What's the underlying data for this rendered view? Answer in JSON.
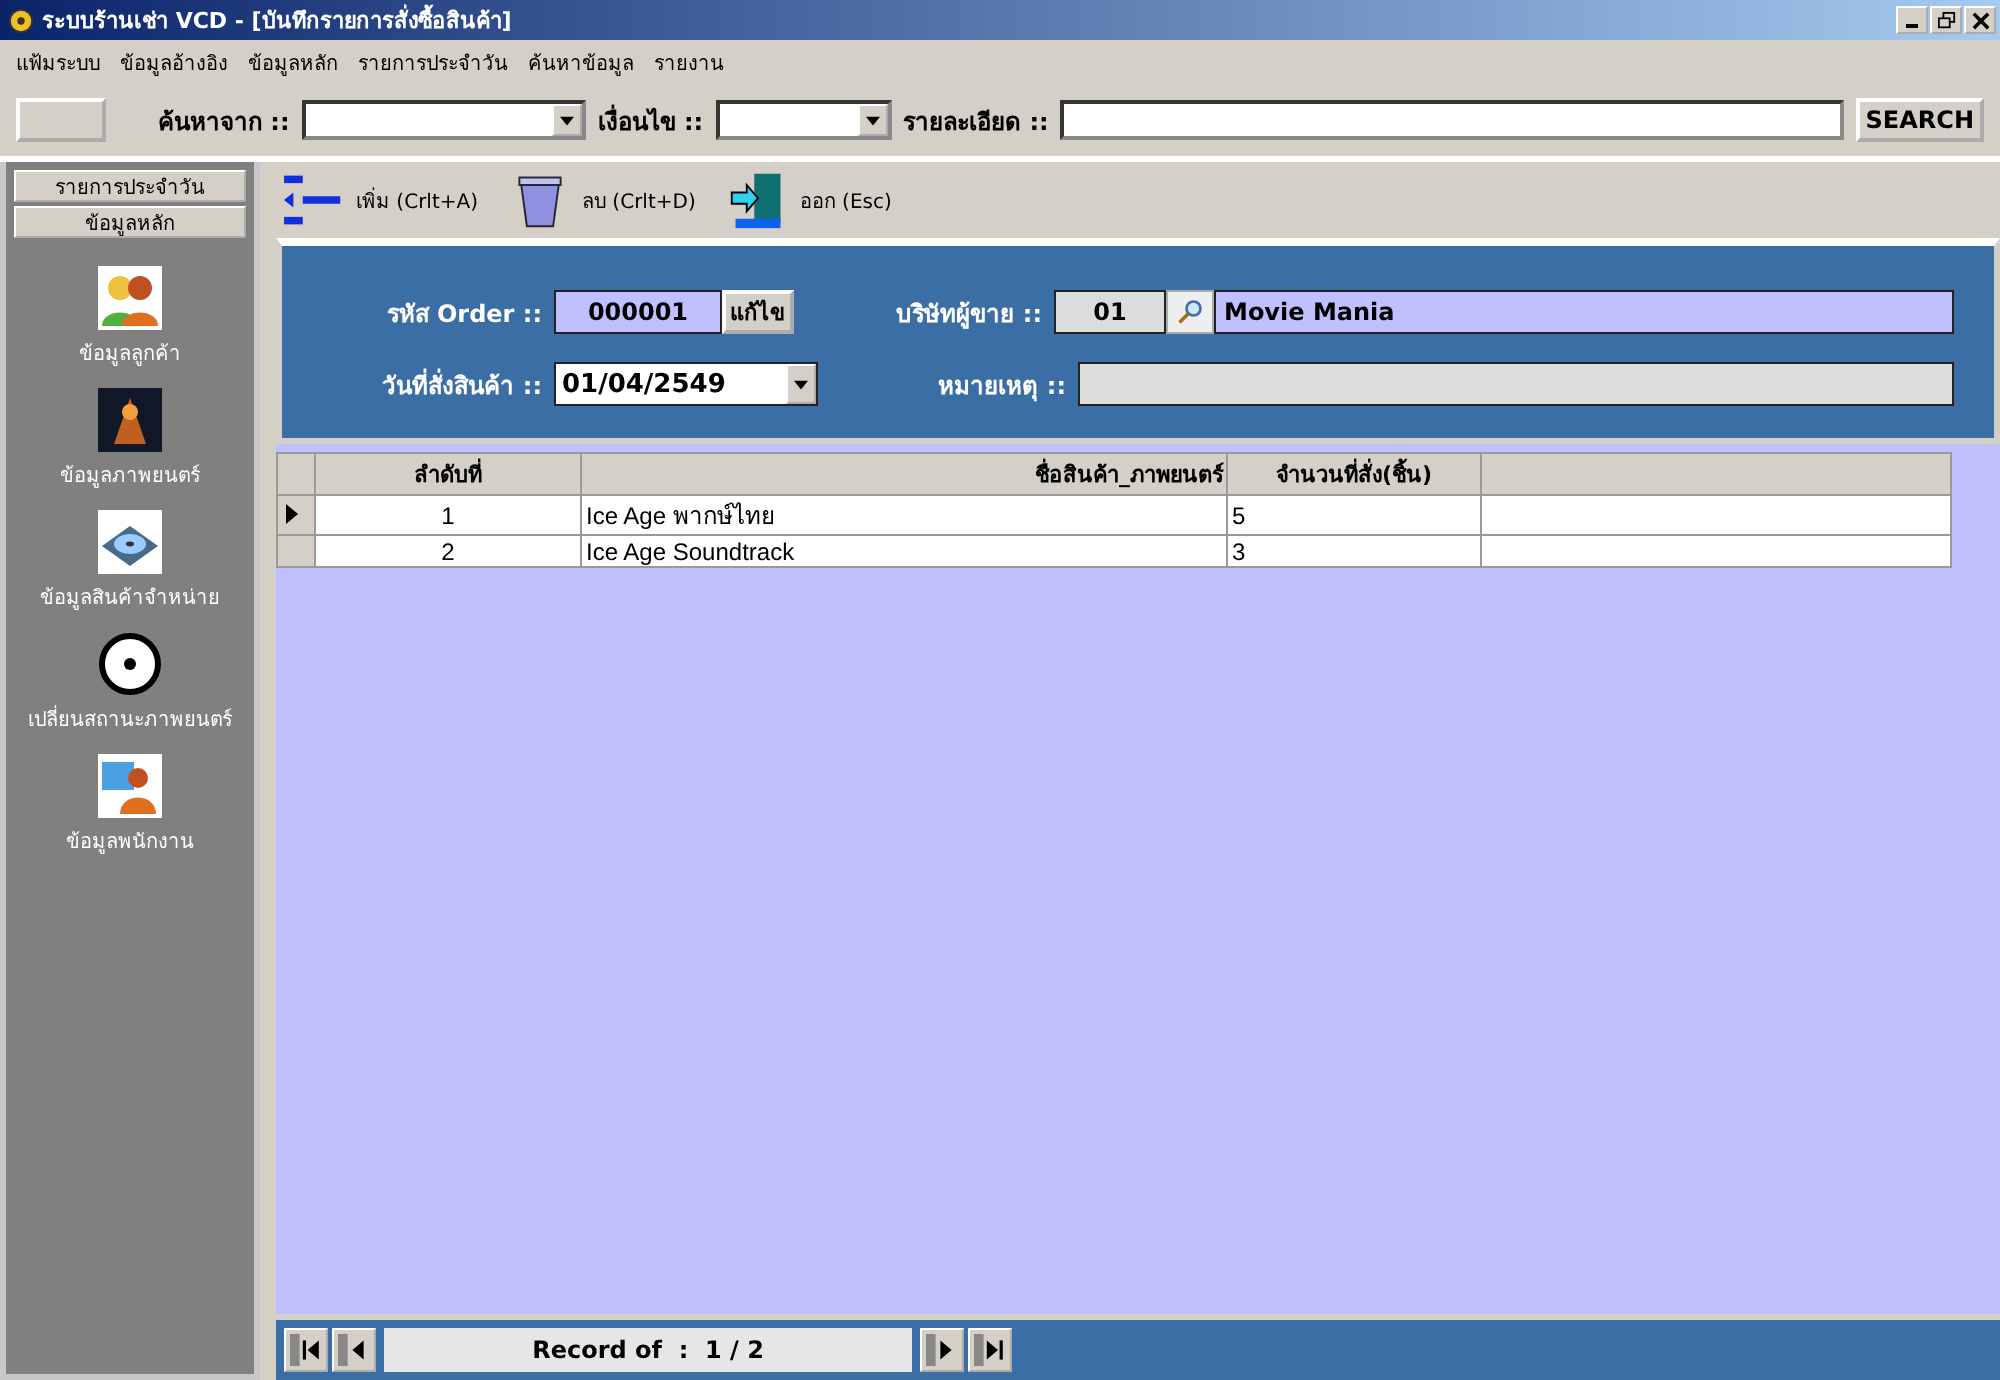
{
  "window": {
    "title": "ระบบร้านเช่า VCD - [บันทึกรายการสั่งซื้อสินค้า]"
  },
  "menu": [
    "แฟ้มระบบ",
    "ข้อมูลอ้างอิง",
    "ข้อมูลหลัก",
    "รายการประจำวัน",
    "ค้นหาข้อมูล",
    "รายงาน"
  ],
  "search_bar": {
    "from_label": "ค้นหาจาก ::",
    "condition_label": "เงื่อนไข ::",
    "detail_label": "รายละเอียด ::",
    "button": "SEARCH"
  },
  "sidebar": {
    "sections": [
      "รายการประจำวัน",
      "ข้อมูลหลัก"
    ],
    "items": [
      {
        "kind": "customers",
        "label": "ข้อมูลลูกค้า"
      },
      {
        "kind": "movies",
        "label": "ข้อมูลภาพยนตร์"
      },
      {
        "kind": "products",
        "label": "ข้อมูลสินค้าจำหน่าย"
      },
      {
        "kind": "disc",
        "label": "เปลี่ยนสถานะภาพยนตร์"
      },
      {
        "kind": "staff",
        "label": "ข้อมูลพนักงาน"
      }
    ]
  },
  "toolbar": [
    {
      "kind": "add",
      "label": "เพิ่ม (Crlt+A)"
    },
    {
      "kind": "delete",
      "label": "ลบ (Crlt+D)"
    },
    {
      "kind": "exit",
      "label": "ออก (Esc)"
    }
  ],
  "form": {
    "order_label": "รหัส Order ::",
    "order_value": "000001",
    "edit_button": "แก้ไข",
    "supplier_label": "บริษัทผู้ขาย ::",
    "supplier_code": "01",
    "supplier_name": "Movie Mania",
    "date_label": "วันที่สั่งสินค้า ::",
    "date_value": "01/04/2549",
    "note_label": "หมายเหตุ ::"
  },
  "table": {
    "columns": [
      "ลำดับที่",
      "ชื่อสินค้า_ภาพยนตร์",
      "จำนวนที่สั่ง(ชิ้น)"
    ],
    "rows": [
      {
        "selected": true,
        "cells": [
          "1",
          "Ice Age พากษ์ไทย",
          "5"
        ]
      },
      {
        "selected": false,
        "cells": [
          "2",
          "Ice Age Soundtrack",
          "3"
        ]
      }
    ]
  },
  "navigator": {
    "text": "Record of  :  1 / 2"
  }
}
